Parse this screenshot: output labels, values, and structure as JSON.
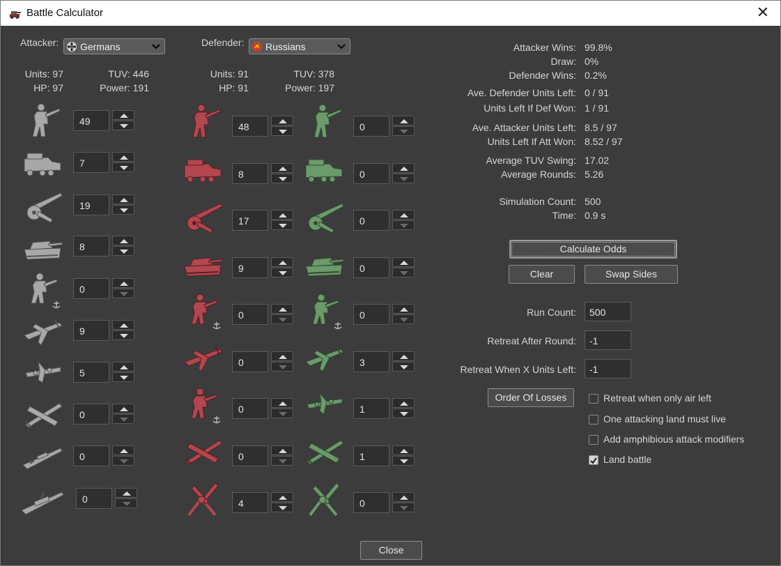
{
  "window": {
    "title": "Battle Calculator"
  },
  "attacker": {
    "label": "Attacker:",
    "nation": "Germans",
    "units_text": "Units: 97",
    "tuv_text": "TUV: 446",
    "hp_text": "HP: 97",
    "power_text": "Power: 191",
    "units": [
      {
        "icon": "german-infantry-icon",
        "count": "49"
      },
      {
        "icon": "german-halftrack-icon",
        "count": "7"
      },
      {
        "icon": "german-artillery-icon",
        "count": "19"
      },
      {
        "icon": "german-tank-icon",
        "count": "8"
      },
      {
        "icon": "german-marine-icon",
        "count": "0"
      },
      {
        "icon": "german-fighter-icon",
        "count": "9"
      },
      {
        "icon": "german-tactical-bomber-icon",
        "count": "5"
      },
      {
        "icon": "german-bomber-icon",
        "count": "0"
      },
      {
        "icon": "german-destroyer-icon",
        "count": "0"
      },
      {
        "icon": "german-cruiser-icon",
        "count": "0"
      }
    ]
  },
  "defender": {
    "label": "Defender:",
    "nation": "Russians",
    "units_text": "Units: 91",
    "tuv_text": "TUV: 378",
    "hp_text": "HP: 91",
    "power_text": "Power: 197",
    "units": [
      {
        "icon": "russian-infantry-icon",
        "count": "48"
      },
      {
        "icon": "russian-halftrack-icon",
        "count": "8"
      },
      {
        "icon": "russian-artillery-icon",
        "count": "17"
      },
      {
        "icon": "russian-tank-icon",
        "count": "9"
      },
      {
        "icon": "russian-marine-icon",
        "count": "0"
      },
      {
        "icon": "russian-fighter-icon",
        "count": "0"
      },
      {
        "icon": "russian-submarine-icon",
        "count": "0"
      },
      {
        "icon": "russian-bomber-icon",
        "count": "0"
      },
      {
        "icon": "russian-aa-gun-icon",
        "count": "4"
      }
    ],
    "allied_units": [
      {
        "icon": "allied-infantry-icon",
        "count": "0"
      },
      {
        "icon": "allied-halftrack-icon",
        "count": "0"
      },
      {
        "icon": "allied-artillery-icon",
        "count": "0"
      },
      {
        "icon": "allied-tank-icon",
        "count": "0"
      },
      {
        "icon": "allied-marine-icon",
        "count": "0"
      },
      {
        "icon": "allied-fighter-icon",
        "count": "3"
      },
      {
        "icon": "allied-tactical-bomber-icon",
        "count": "1"
      },
      {
        "icon": "allied-bomber-icon",
        "count": "1"
      },
      {
        "icon": "allied-aa-gun-icon",
        "count": "0"
      }
    ]
  },
  "results": {
    "rows": [
      {
        "label": "Attacker Wins:",
        "value": "99.8%"
      },
      {
        "label": "Draw:",
        "value": "0%"
      },
      {
        "label": "Defender Wins:",
        "value": "0.2%"
      },
      {
        "label": "Ave. Defender Units Left:",
        "value": "0 / 91"
      },
      {
        "label": "Units Left If Def Won:",
        "value": "1 / 91"
      },
      {
        "label": "Ave. Attacker Units Left:",
        "value": "8.5 / 97"
      },
      {
        "label": "Units Left If Att Won:",
        "value": "8.52 / 97"
      },
      {
        "label": "Average TUV Swing:",
        "value": "17.02"
      },
      {
        "label": "Average Rounds:",
        "value": "5.26"
      },
      {
        "label": "Simulation Count:",
        "value": "500"
      },
      {
        "label": "Time:",
        "value": "0.9 s"
      }
    ]
  },
  "buttons": {
    "calculate": "Calculate Odds",
    "clear": "Clear",
    "swap": "Swap Sides",
    "order_of_losses": "Order Of Losses",
    "close": "Close"
  },
  "settings": {
    "run_count_label": "Run Count:",
    "run_count": "500",
    "retreat_round_label": "Retreat After Round:",
    "retreat_round": "-1",
    "retreat_units_label": "Retreat When X Units Left:",
    "retreat_units": "-1"
  },
  "checkboxes": [
    {
      "label": "Retreat when only air left",
      "checked": false
    },
    {
      "label": "One attacking land must live",
      "checked": false
    },
    {
      "label": "Add amphibious attack modifiers",
      "checked": false
    },
    {
      "label": "Land battle",
      "checked": true
    }
  ],
  "colors": {
    "german": "#a8a8a8",
    "russian": "#b2474f",
    "allied": "#6b9a6b",
    "background": "#3c3c3c"
  }
}
